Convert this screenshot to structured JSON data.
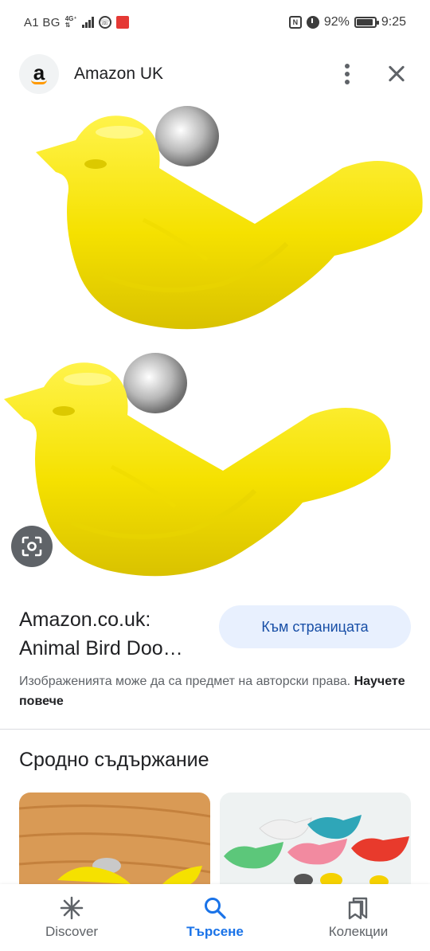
{
  "status_bar": {
    "carrier": "A1 BG",
    "network_top": "4G⁺",
    "network_bottom": "⇅",
    "battery": "92%",
    "time": "9:25"
  },
  "header": {
    "logo_letter": "a",
    "site_name": "Amazon UK"
  },
  "result": {
    "title": "Amazon.co.uk: Animal Bird Doo…",
    "visit_button": "Към страницата",
    "copyright_text": "Изображенията може да са предмет на авторски права.",
    "learn_more": "Научете повече"
  },
  "related": {
    "title": "Сродно съдържание"
  },
  "bottom_nav": [
    {
      "label": "Discover",
      "icon": "asterisk-icon",
      "active": false
    },
    {
      "label": "Търсене",
      "icon": "search-icon",
      "active": true
    },
    {
      "label": "Колекции",
      "icon": "collections-icon",
      "active": false
    }
  ],
  "colors": {
    "accent": "#1a73e8",
    "button_bg": "#e8f0fe",
    "bird_yellow": "#f7e600"
  }
}
